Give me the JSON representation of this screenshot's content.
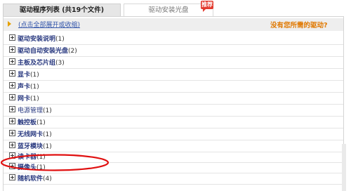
{
  "tabs": {
    "active": "驱动程序列表 (共19个文件)",
    "inactive": "驱动安装光盘",
    "badge": "推荐"
  },
  "toolbar": {
    "expand_link": "(点击全部展开或收缩)",
    "missing_link": "没有您所需的驱动?"
  },
  "categories": [
    {
      "label": "驱动安装说明",
      "count": "(1)",
      "bold": true
    },
    {
      "label": "驱动自动安装光盘",
      "count": "(2)",
      "bold": true
    },
    {
      "label": "主板及芯片组",
      "count": "(3)",
      "bold": true
    },
    {
      "label": "显卡",
      "count": "(1)",
      "bold": true
    },
    {
      "label": "声卡",
      "count": "(1)",
      "bold": true
    },
    {
      "label": "网卡",
      "count": "(1)",
      "bold": true
    },
    {
      "label": "电源管理",
      "count": "(1)",
      "bold": false
    },
    {
      "label": "触控板",
      "count": "(1)",
      "bold": true
    },
    {
      "label": "无线网卡",
      "count": "(1)",
      "bold": true
    },
    {
      "label": "蓝牙模块",
      "count": "(1)",
      "bold": true
    },
    {
      "label": "读卡器",
      "count": "(1)",
      "bold": true
    },
    {
      "label": "摄像头",
      "count": "(1)",
      "bold": true
    },
    {
      "label": "随机软件",
      "count": "(4)",
      "bold": true
    }
  ],
  "colors": {
    "accent_orange": "#e07800",
    "link_blue": "#3355aa",
    "annotation_red": "#e01010"
  }
}
